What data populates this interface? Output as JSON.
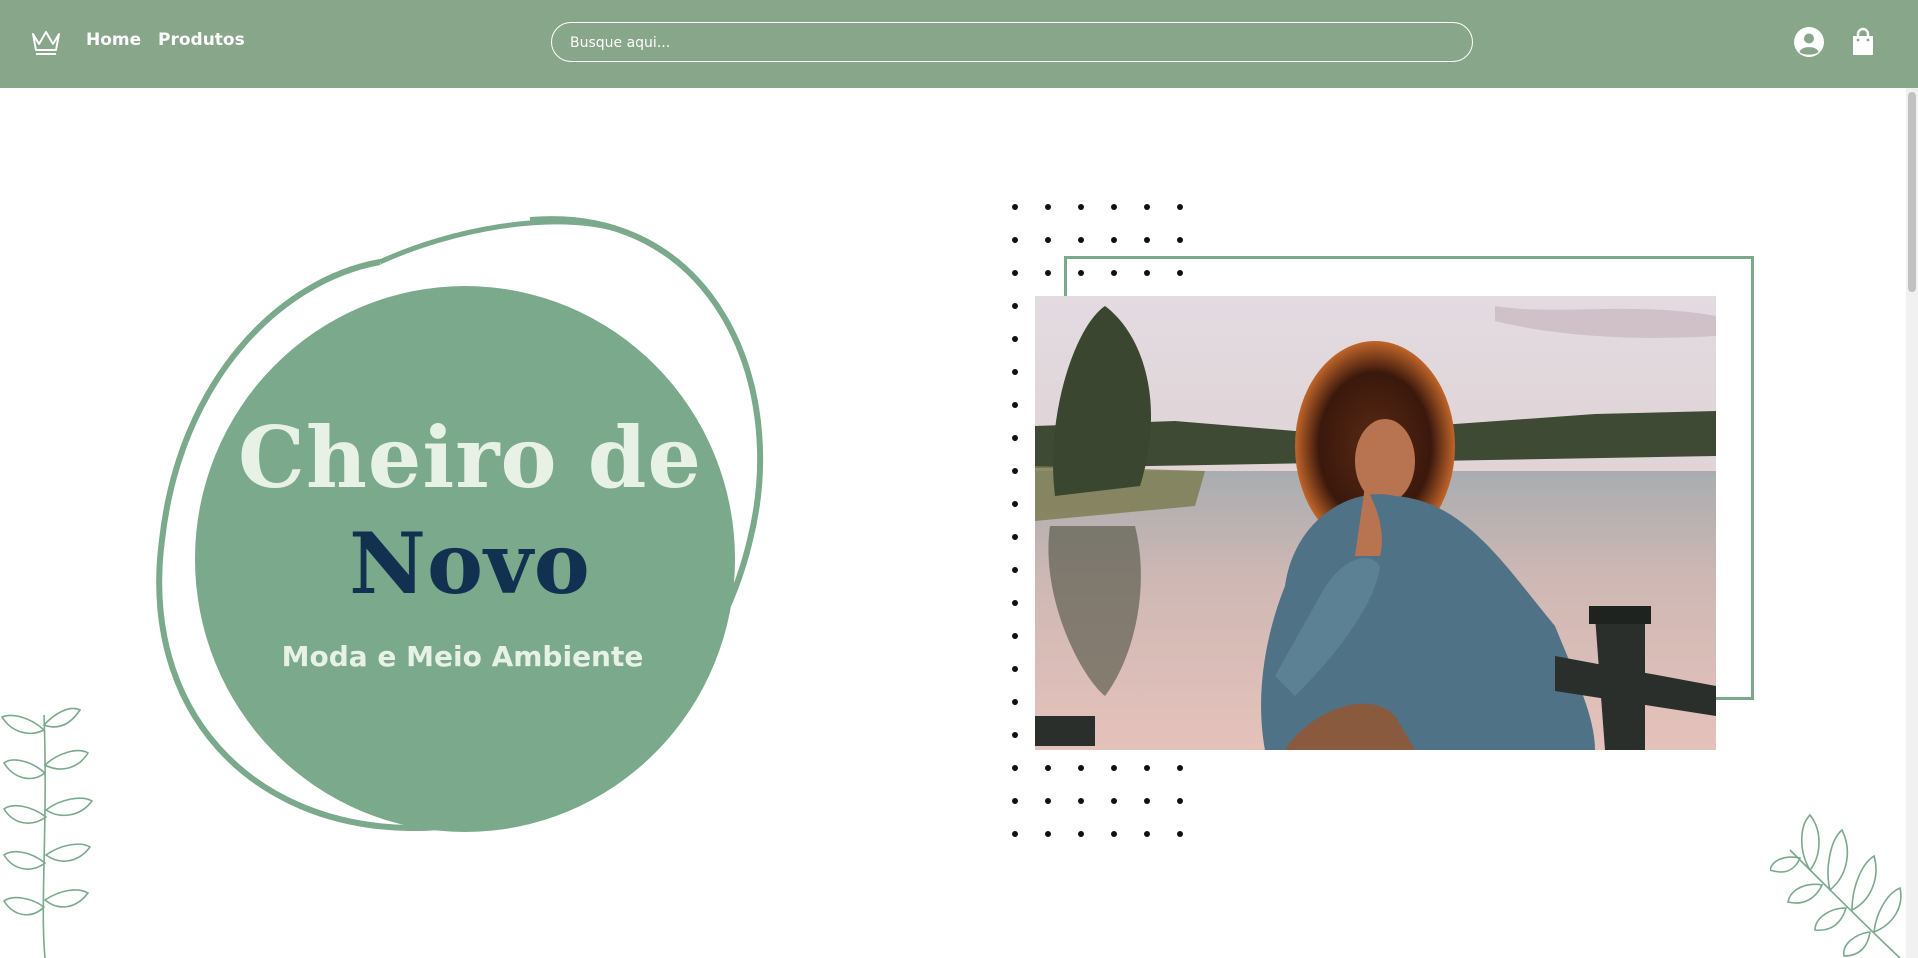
{
  "nav": {
    "links": [
      {
        "label": "Home"
      },
      {
        "label": "Produtos"
      }
    ]
  },
  "search": {
    "value": "",
    "placeholder": "Busque aqui..."
  },
  "hero": {
    "title_line1": "Cheiro de",
    "title_line2": "Novo",
    "subtitle": "Moda e Meio Ambiente"
  },
  "colors": {
    "header_bg": "#87a68a",
    "accent_green": "#7aa98c",
    "title_light": "#e7f1e6",
    "title_dark": "#12304f"
  },
  "icons": [
    "crown-icon",
    "user-icon",
    "shopping-bag-icon",
    "leaf-branch-icon"
  ]
}
